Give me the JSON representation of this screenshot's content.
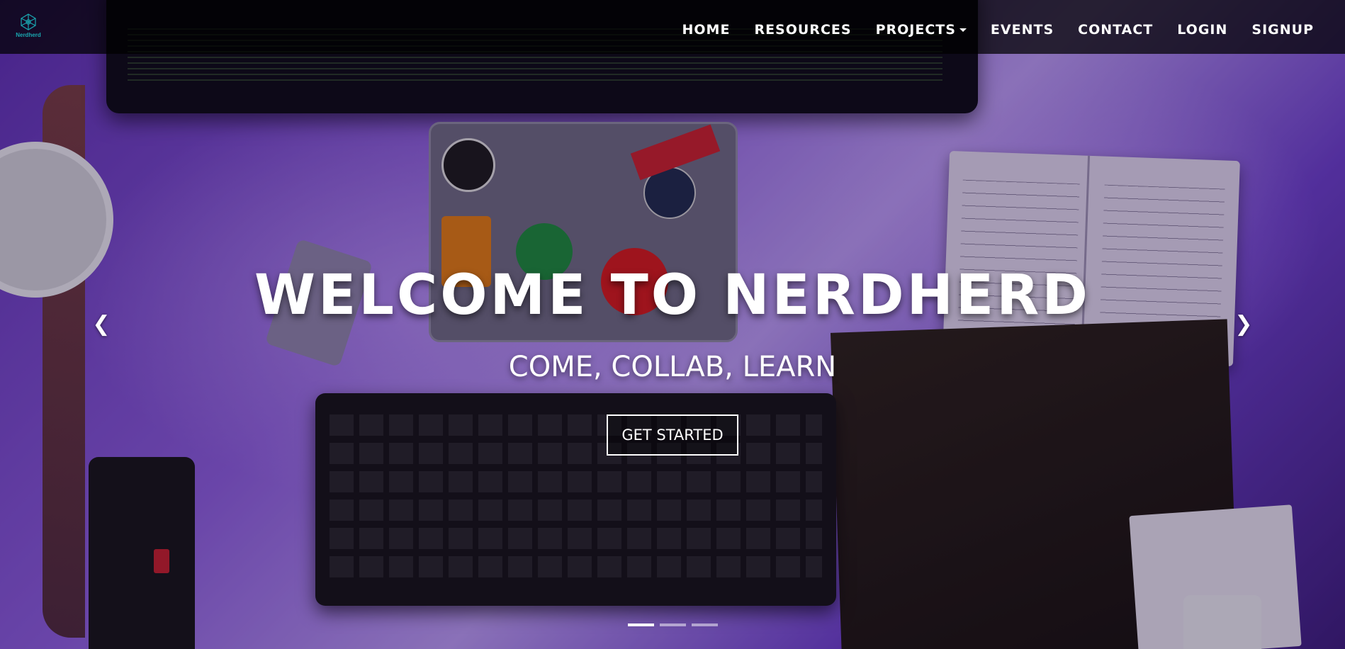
{
  "brand": {
    "name": "Nerdherd",
    "logo_icon": "network-logo-icon",
    "logo_color": "#1aa7b0"
  },
  "nav": {
    "items": [
      {
        "label": "HOME",
        "icon": null
      },
      {
        "label": "RESOURCES",
        "icon": null
      },
      {
        "label": "PROJECTS",
        "icon": "caret-down-icon"
      },
      {
        "label": "EVENTS",
        "icon": null
      },
      {
        "label": "CONTACT",
        "icon": null
      },
      {
        "label": "LOGIN",
        "icon": null
      },
      {
        "label": "SIGNUP",
        "icon": null
      }
    ]
  },
  "hero": {
    "title": "WELCOME TO NERDHERD",
    "subtitle": "COME, COLLAB, LEARN",
    "cta_label": "GET STARTED",
    "prev_icon": "chevron-left-icon",
    "next_icon": "chevron-right-icon",
    "slide_count": 3,
    "active_slide": 1
  },
  "colors": {
    "navbar_bg": "#000000",
    "text": "#ffffff",
    "accent": "#1aa7b0",
    "hero_tint": "#7a4fd0"
  }
}
